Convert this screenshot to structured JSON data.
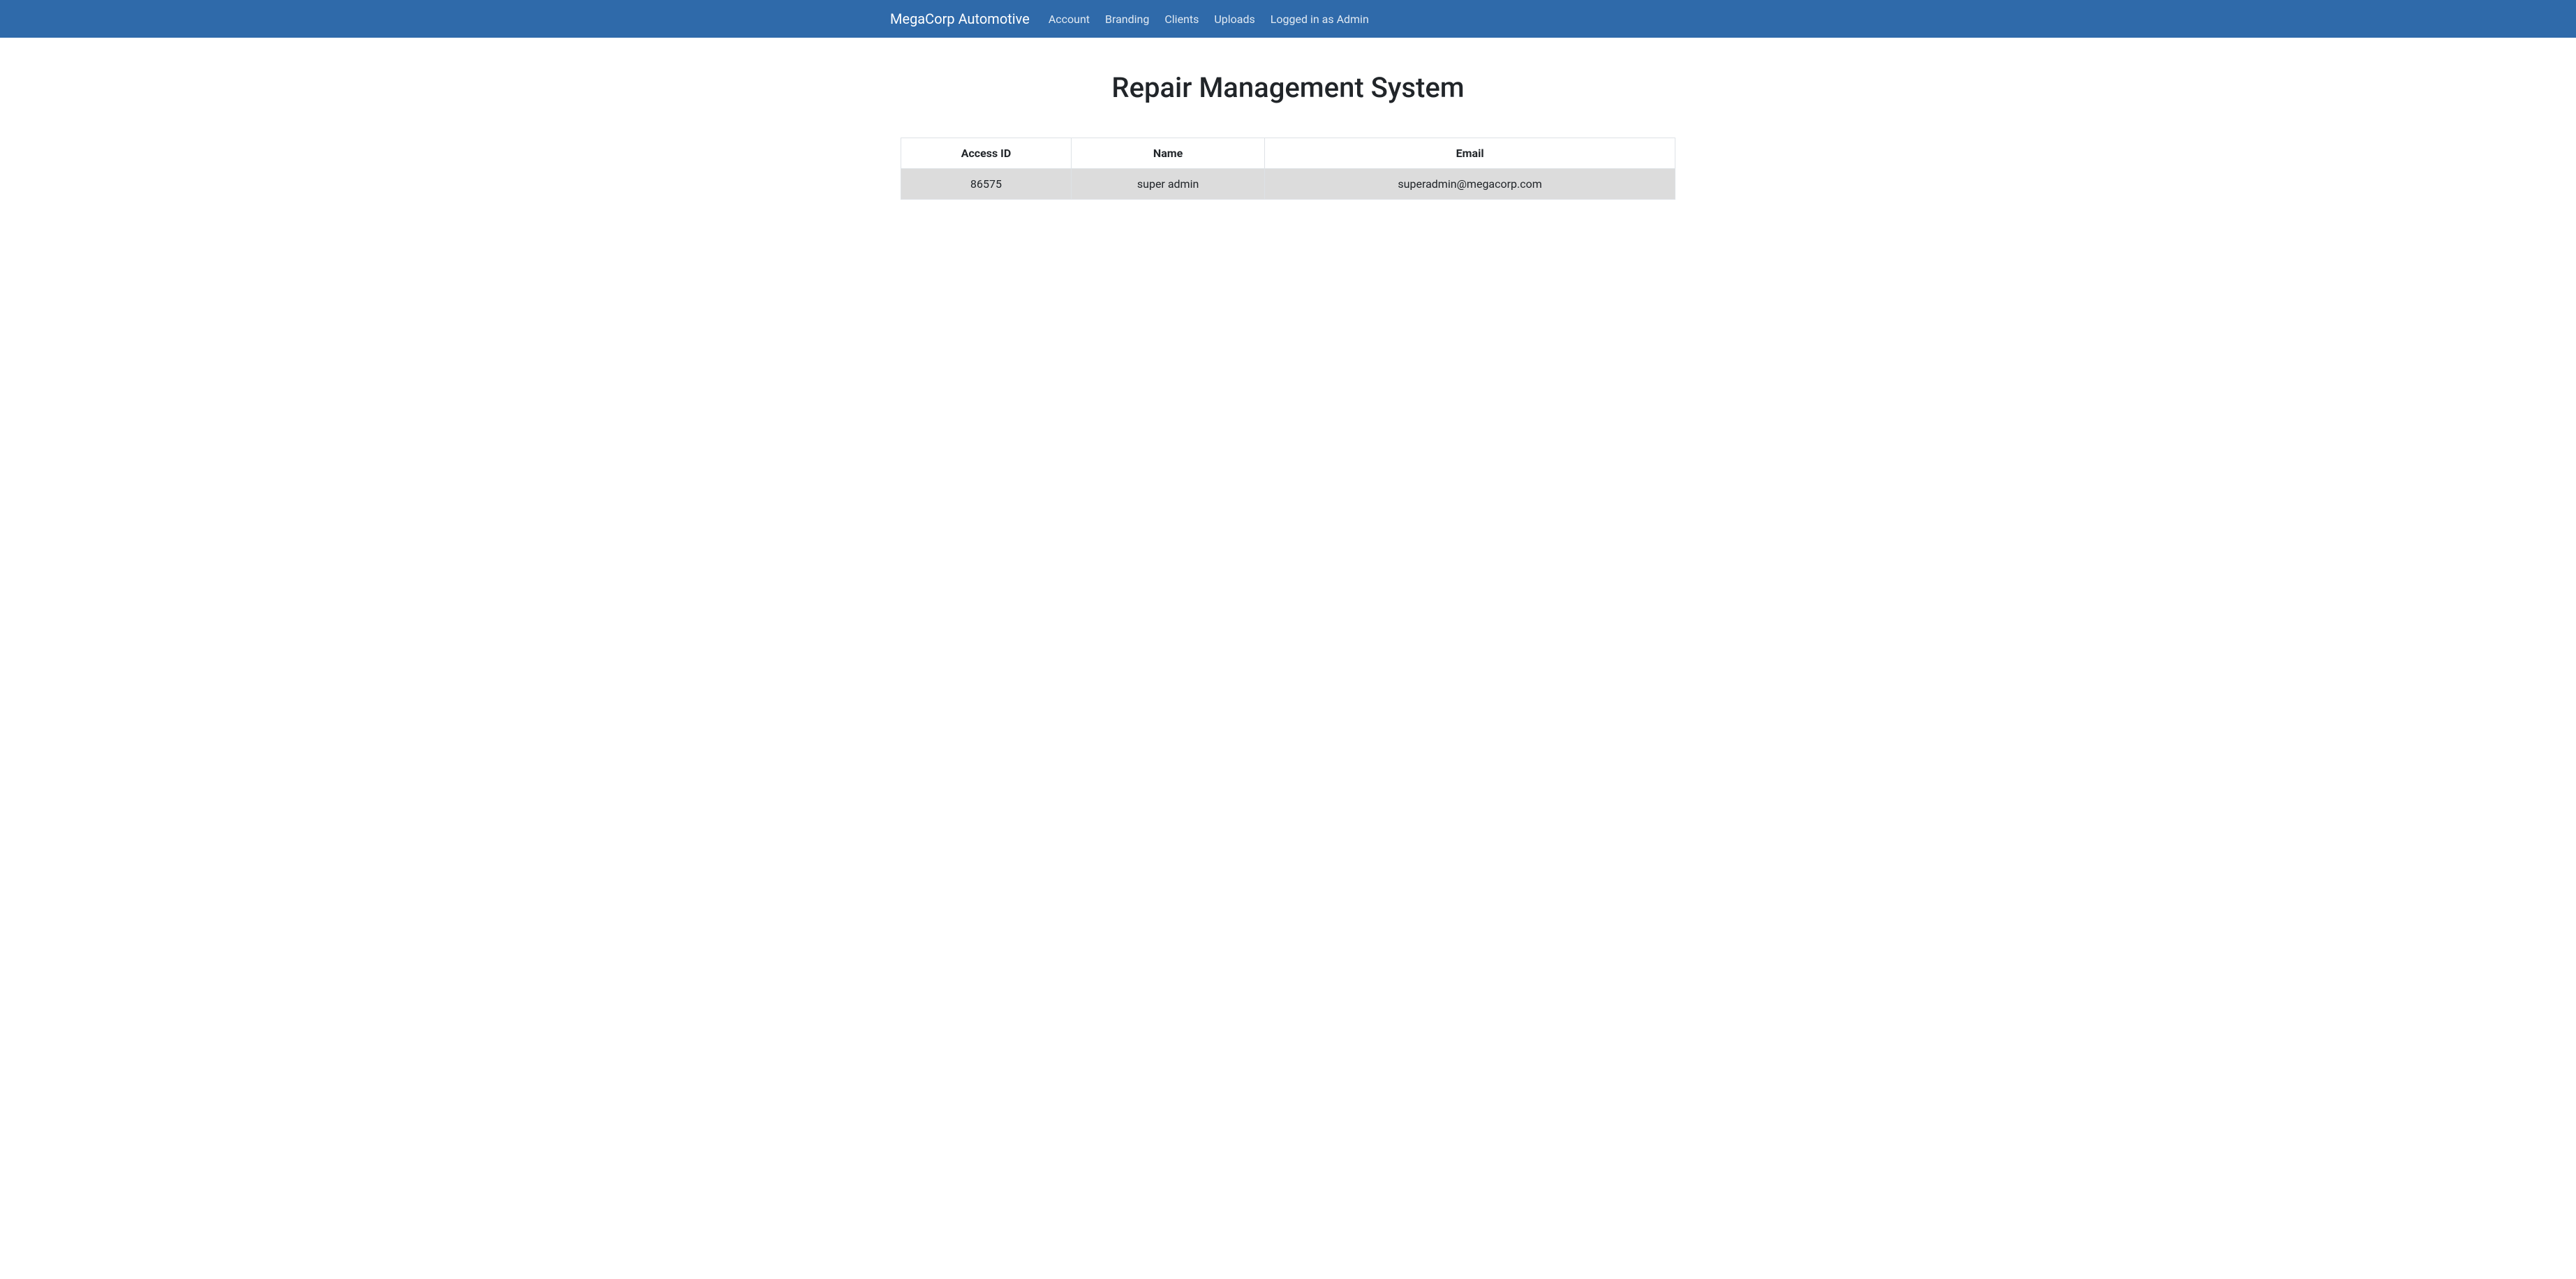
{
  "navbar": {
    "brand": "MegaCorp Automotive",
    "links": [
      {
        "label": "Account"
      },
      {
        "label": "Branding"
      },
      {
        "label": "Clients"
      },
      {
        "label": "Uploads"
      },
      {
        "label": "Logged in as Admin"
      }
    ]
  },
  "page": {
    "title": "Repair Management System"
  },
  "table": {
    "headers": {
      "access_id": "Access ID",
      "name": "Name",
      "email": "Email"
    },
    "rows": [
      {
        "access_id": "86575",
        "name": "super admin",
        "email": "superadmin@megacorp.com"
      }
    ]
  }
}
